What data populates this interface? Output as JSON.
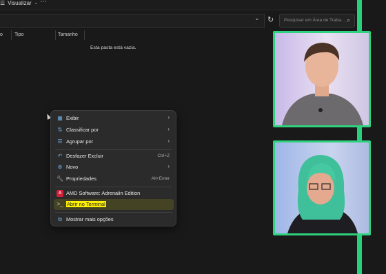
{
  "toolbar": {
    "view_label": "Visualizar",
    "more_icon": "more-icon"
  },
  "addressbar": {
    "chevron_icon": "chevron-down-icon",
    "refresh_icon": "refresh-icon"
  },
  "search": {
    "placeholder": "Pesquisar em Área de Traba...",
    "icon": "search-icon"
  },
  "columns": {
    "col_partial": "o",
    "type": "Tipo",
    "size": "Tamanho"
  },
  "content": {
    "empty_message": "Esta pasta está vazia."
  },
  "context_menu": {
    "items": [
      {
        "label": "Exibir",
        "icon": "view-grid-icon",
        "submenu": true,
        "shortcut": ""
      },
      {
        "label": "Classificar por",
        "icon": "sort-icon",
        "submenu": true,
        "shortcut": ""
      },
      {
        "label": "Agrupar por",
        "icon": "group-icon",
        "submenu": true,
        "shortcut": ""
      },
      {
        "label": "Desfazer Excluir",
        "icon": "undo-icon",
        "submenu": false,
        "shortcut": "Ctrl+Z"
      },
      {
        "label": "Novo",
        "icon": "new-icon",
        "submenu": true,
        "shortcut": ""
      },
      {
        "label": "Propriedades",
        "icon": "properties-icon",
        "submenu": false,
        "shortcut": "Alt+Enter"
      },
      {
        "label": "AMD Software: Adrenalin Edition",
        "icon": "amd-icon",
        "submenu": false,
        "shortcut": ""
      },
      {
        "label": "Abrir no Terminal",
        "icon": "terminal-icon",
        "submenu": false,
        "shortcut": "",
        "highlighted": true
      },
      {
        "label": "Mostrar mais opções",
        "icon": "more-options-icon",
        "submenu": false,
        "shortcut": ""
      }
    ]
  },
  "colors": {
    "accent_green": "#2fd27f",
    "highlight_yellow": "#fff200",
    "menu_bg": "#2b2b2b",
    "window_bg": "#191919"
  }
}
